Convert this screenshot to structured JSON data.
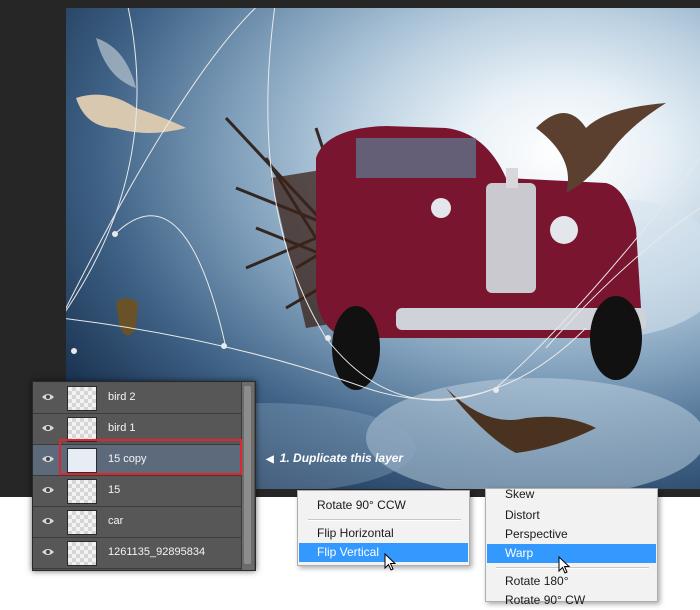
{
  "canvas": {
    "description_free": true,
    "sky_colors": [
      "#ffffff",
      "#7c9cb8",
      "#0e1f35"
    ],
    "car_color": "#7a1530"
  },
  "layers_panel": {
    "layers": [
      {
        "name": "bird 2",
        "selected": false
      },
      {
        "name": "bird 1",
        "selected": false
      },
      {
        "name": "15 copy",
        "selected": true
      },
      {
        "name": "15",
        "selected": false
      },
      {
        "name": "car",
        "selected": false
      },
      {
        "name": "1261135_92895834",
        "selected": false
      }
    ],
    "eye_icon": "eye-icon"
  },
  "callout": {
    "text": "1. Duplicate this layer",
    "pointer_icon": "triangle-left-icon"
  },
  "menu_left": {
    "items": [
      "Rotate 90° CCW",
      "Flip Horizontal",
      "Flip Vertical"
    ],
    "active": "Flip Vertical"
  },
  "menu_right": {
    "items": [
      "Skew",
      "Distort",
      "Perspective",
      "Warp",
      "Rotate 180°",
      "Rotate 90° CW"
    ],
    "active": "Warp"
  },
  "colors": {
    "highlight_border": "#e0262c",
    "menu_active": "#3399ff",
    "panel_bg": "#535353",
    "selected_row": "#5d6a7c"
  }
}
